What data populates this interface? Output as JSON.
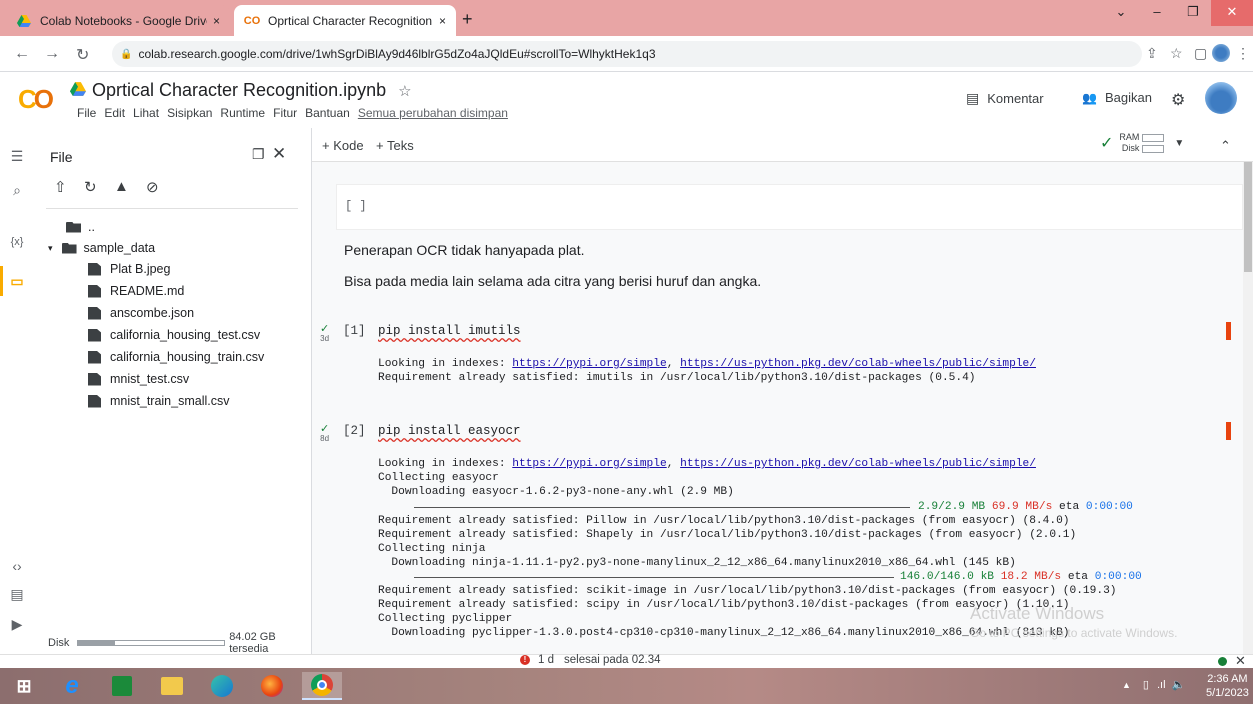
{
  "browser": {
    "tabs": [
      {
        "title": "Colab Notebooks - Google Drive",
        "close": "×"
      },
      {
        "title": "Oprtical Character Recognition.ip",
        "close": "×"
      }
    ],
    "new_tab": "+",
    "url": "colab.research.google.com/drive/1whSgrDiBlAy9d46lblrG5dZo4aJQldEu#scrollTo=WlhyktHek1q3"
  },
  "colab": {
    "notebook_title": "Oprtical Character Recognition.ipynb",
    "menu": [
      "File",
      "Edit",
      "Lihat",
      "Sisipkan",
      "Runtime",
      "Fitur",
      "Bantuan"
    ],
    "saved_status": "Semua perubahan disimpan",
    "comment_label": "Komentar",
    "share_label": "Bagikan",
    "add_code": "+ Kode",
    "add_text": "+ Teks",
    "ram_label": "RAM",
    "disk_label": "Disk"
  },
  "file_panel": {
    "title": "File",
    "parent_dir": "..",
    "folder": "sample_data",
    "files": [
      "Plat B.jpeg",
      "README.md",
      "anscombe.json",
      "california_housing_test.csv",
      "california_housing_train.csv",
      "mnist_test.csv",
      "mnist_train_small.csv"
    ],
    "disk_label": "Disk",
    "disk_free": "84.02 GB tersedia",
    "disk_used_fraction": 0.25
  },
  "notebook": {
    "empty_cell_prompt": "[ ]",
    "text1": "Penerapan OCR tidak hanyapada plat.",
    "text2": "Bisa pada media lain selama ada citra yang berisi huruf dan angka.",
    "cells": [
      {
        "num": "[1]",
        "time": "3d",
        "code": "pip install imutils",
        "out1_prefix": "Looking in indexes: ",
        "out1_link1": "https://pypi.org/simple",
        "out1_sep": ", ",
        "out1_link2": "https://us-python.pkg.dev/colab-wheels/public/simple/",
        "out2": "Requirement already satisfied: imutils in /usr/local/lib/python3.10/dist-packages (0.5.4)"
      },
      {
        "num": "[2]",
        "time": "8d",
        "code": "pip install easyocr",
        "out1_prefix": "Looking in indexes: ",
        "out1_link1": "https://pypi.org/simple",
        "out1_sep": ", ",
        "out1_link2": "https://us-python.pkg.dev/colab-wheels/public/simple/",
        "out2": "Collecting easyocr",
        "out3": "  Downloading easyocr-1.6.2-py3-none-any.whl (2.9 MB)",
        "prog1_size": "2.9/2.9 MB",
        "prog1_speed": "69.9 MB/s",
        "prog1_eta_label": "eta",
        "prog1_eta": "0:00:00",
        "out4": "Requirement already satisfied: Pillow in /usr/local/lib/python3.10/dist-packages (from easyocr) (8.4.0)",
        "out5": "Requirement already satisfied: Shapely in /usr/local/lib/python3.10/dist-packages (from easyocr) (2.0.1)",
        "out6": "Collecting ninja",
        "out7": "  Downloading ninja-1.11.1-py2.py3-none-manylinux_2_12_x86_64.manylinux2010_x86_64.whl (145 kB)",
        "prog2_size": "146.0/146.0 kB",
        "prog2_speed": "18.2 MB/s",
        "prog2_eta_label": "eta",
        "prog2_eta": "0:00:00",
        "out8": "Requirement already satisfied: scikit-image in /usr/local/lib/python3.10/dist-packages (from easyocr) (0.19.3)",
        "out9": "Requirement already satisfied: scipy in /usr/local/lib/python3.10/dist-packages (from easyocr) (1.10.1)",
        "out10": "Collecting pyclipper",
        "out11": "  Downloading pyclipper-1.3.0.post4-cp310-cp310-manylinux_2_12_x86_64.manylinux2010_x86_64.whl (813 kB)"
      }
    ]
  },
  "watermark": {
    "line1": "Activate Windows",
    "line2": "Go to PC settings to activate Windows."
  },
  "status": {
    "time": "1 d",
    "done": "selesai pada 02.34",
    "alert": "!"
  },
  "taskbar": {
    "time": "2:36 AM",
    "date": "5/1/2023"
  },
  "colors": {
    "accent": "#f9ab00",
    "link": "#1a0dab",
    "green": "#188038",
    "red": "#d93025"
  }
}
